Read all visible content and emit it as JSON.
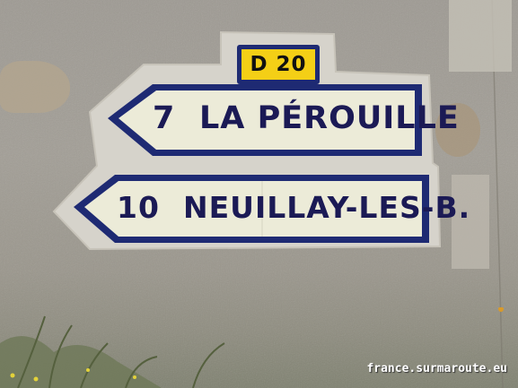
{
  "road_number": "D 20",
  "signs": [
    {
      "distance": "7",
      "destination": "LA PÉROUILLE"
    },
    {
      "distance": "10",
      "destination": "NEUILLAY-LES-B."
    }
  ],
  "watermark": "france.surmaroute.eu",
  "colors": {
    "sign_border": "#1e2a73",
    "sign_face": "#ecebd8",
    "plate_yellow": "#f4cf16"
  }
}
